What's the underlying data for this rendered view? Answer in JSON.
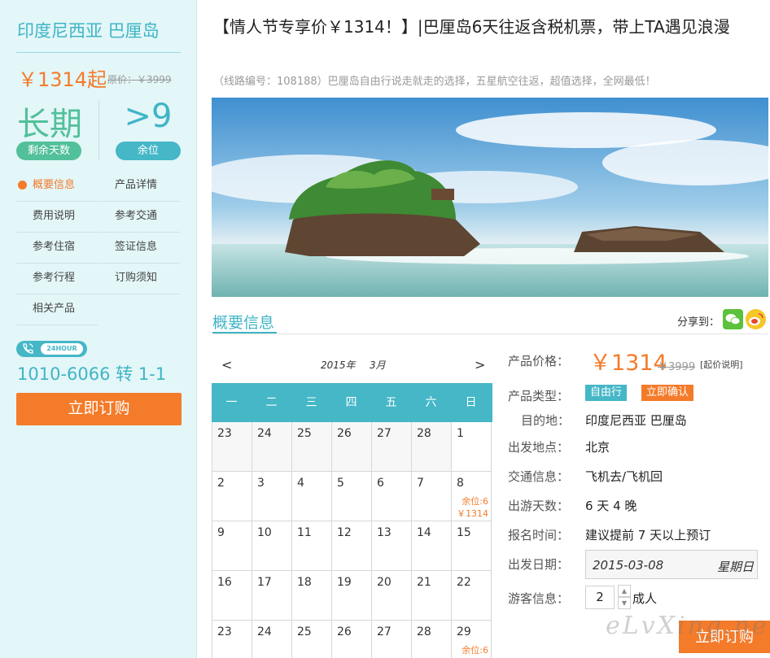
{
  "sidebar": {
    "destination": "印度尼西亚 巴厘岛",
    "price": "￥1314起",
    "original_price": "原价：￥3999",
    "remaining_days": "长期",
    "remaining_days_label": "剩余天数",
    "seats": ">9",
    "seats_label": "余位",
    "nav": [
      {
        "label": "概要信息",
        "active": true
      },
      {
        "label": "产品详情"
      },
      {
        "label": "费用说明"
      },
      {
        "label": "参考交通"
      },
      {
        "label": "参考住宿"
      },
      {
        "label": "签证信息"
      },
      {
        "label": "参考行程"
      },
      {
        "label": "订购须知"
      },
      {
        "label": "相关产品"
      }
    ],
    "hotline_badge": "24HOUR",
    "phone": "1010-6066 转 1-1",
    "book_label": "立即订购"
  },
  "product": {
    "title": "【情人节专享价￥1314！】|巴厘岛6天往返含税机票，带上TA遇见浪漫",
    "subtitle": "（线路编号：108188）巴厘岛自由行说走就走的选择，五星航空往返，超值选择，全网最低！"
  },
  "section": {
    "title": "概要信息",
    "share_label": "分享到："
  },
  "calendar": {
    "prev": "<",
    "next": ">",
    "year": "2015年",
    "month": "3月",
    "weekdays": [
      "一",
      "二",
      "三",
      "四",
      "五",
      "六",
      "日"
    ],
    "rows": [
      [
        {
          "d": "23",
          "m": true
        },
        {
          "d": "24",
          "m": true
        },
        {
          "d": "25",
          "m": true
        },
        {
          "d": "26",
          "m": true
        },
        {
          "d": "27",
          "m": true
        },
        {
          "d": "28",
          "m": true
        },
        {
          "d": "1"
        }
      ],
      [
        {
          "d": "2"
        },
        {
          "d": "3"
        },
        {
          "d": "4"
        },
        {
          "d": "5"
        },
        {
          "d": "6"
        },
        {
          "d": "7"
        },
        {
          "d": "8",
          "seat": "余位:6",
          "price": "￥1314"
        }
      ],
      [
        {
          "d": "9"
        },
        {
          "d": "10"
        },
        {
          "d": "11"
        },
        {
          "d": "12"
        },
        {
          "d": "13"
        },
        {
          "d": "14"
        },
        {
          "d": "15"
        }
      ],
      [
        {
          "d": "16"
        },
        {
          "d": "17"
        },
        {
          "d": "18"
        },
        {
          "d": "19"
        },
        {
          "d": "20"
        },
        {
          "d": "21"
        },
        {
          "d": "22"
        }
      ],
      [
        {
          "d": "23"
        },
        {
          "d": "24"
        },
        {
          "d": "25"
        },
        {
          "d": "26"
        },
        {
          "d": "27"
        },
        {
          "d": "28"
        },
        {
          "d": "29",
          "seat": "余位:6"
        }
      ]
    ]
  },
  "info": {
    "price_label": "产品价格：",
    "price": "￥1314",
    "old_price": "￥3999",
    "price_note": "[起价说明]",
    "type_label": "产品类型：",
    "type_tag1": "自由行",
    "type_tag2": "立即确认",
    "dest_label": "目的地：",
    "dest": "印度尼西亚 巴厘岛",
    "depart_label": "出发地点：",
    "depart": "北京",
    "traffic_label": "交通信息：",
    "traffic": "飞机去/飞机回",
    "days_label": "出游天数：",
    "days": "6 天 4 晚",
    "signup_label": "报名时间：",
    "signup": "建议提前 7 天以上预订",
    "date_label": "出发日期：",
    "date": "2015-03-08",
    "date_weekday": "星期日",
    "guest_label": "游客信息：",
    "guest_qty": "2",
    "guest_unit": "成人",
    "book_label": "立即订购",
    "watermark": "eLvXing.net"
  },
  "colors": {
    "accent": "#45b7c7",
    "orange": "#f47b2a",
    "green": "#52c09a"
  }
}
